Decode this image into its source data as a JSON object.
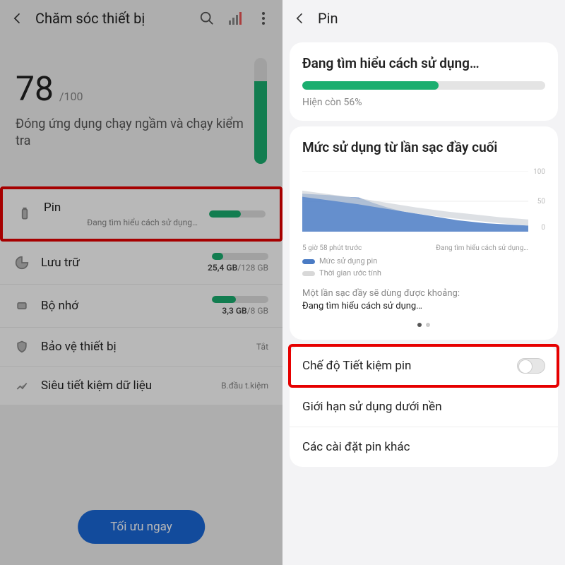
{
  "left": {
    "title": "Chăm sóc thiết bị",
    "score": {
      "value": "78",
      "max": "/100",
      "subtitle": "Đóng ứng dụng chạy ngầm và chạy kiểm tra"
    },
    "rows": {
      "pin": {
        "label": "Pin",
        "detail": "Đang tìm hiểu cách sử dụng…",
        "fill_pct": 56
      },
      "storage": {
        "label": "Lưu trữ",
        "used": "25,4 GB",
        "total": "/128 GB",
        "fill_pct": 20
      },
      "memory": {
        "label": "Bộ nhớ",
        "used": "3,3 GB",
        "total": "/8 GB",
        "fill_pct": 42
      },
      "protect": {
        "label": "Bảo vệ thiết bị",
        "right": "Tắt"
      },
      "data": {
        "label": "Siêu tiết kiệm dữ liệu",
        "right": "B.đầu t.kiệm"
      }
    },
    "cta": "Tối ưu ngay"
  },
  "right": {
    "title": "Pin",
    "learning": {
      "heading": "Đang tìm hiểu cách sử dụng…",
      "remain_text": "Hiện còn 56%",
      "remain_pct": 56
    },
    "usage": {
      "heading": "Mức sử dụng từ lần sạc đầy cuối",
      "x_left": "5 giờ 58 phút trước",
      "x_right": "Đang tìm hiểu cách sử dụng…",
      "legend1": "Mức sử dụng pin",
      "legend2": "Thời gian ước tính",
      "note_lead": "Một lần sạc đầy sẽ dùng được khoảng:",
      "note_val": "Đang tìm hiểu cách sử dụng…",
      "y_top": "100",
      "y_mid": "50",
      "y_bot": "0"
    },
    "options": {
      "saving": "Chế độ Tiết kiệm pin",
      "bg": "Giới hạn sử dụng dưới nền",
      "other": "Các cài đặt pin khác"
    }
  },
  "chart_data": {
    "type": "area",
    "title": "Mức sử dụng từ lần sạc đầy cuối",
    "xlabel": "",
    "ylabel": "%",
    "ylim": [
      0,
      100
    ],
    "x_ticks": [
      "5 giờ 58 phút trước",
      "Đang tìm hiểu cách sử dụng…"
    ],
    "series": [
      {
        "name": "Mức sử dụng pin",
        "x": [
          0,
          1,
          2,
          3,
          4,
          5,
          6,
          7,
          8,
          9,
          10,
          11,
          12,
          13,
          14,
          15,
          16
        ],
        "values": [
          62,
          61,
          60,
          58,
          56,
          48,
          40,
          34,
          30,
          26,
          22,
          19,
          16,
          14,
          12,
          11,
          10
        ]
      },
      {
        "name": "Thời gian ước tính",
        "x": [
          0,
          1,
          2,
          3,
          4,
          5,
          6,
          7,
          8,
          9,
          10,
          11,
          12,
          13,
          14,
          15,
          16
        ],
        "values": [
          62,
          58,
          54,
          50,
          47,
          44,
          41,
          38,
          35,
          32,
          29,
          27,
          25,
          23,
          21,
          19,
          17
        ]
      }
    ]
  }
}
